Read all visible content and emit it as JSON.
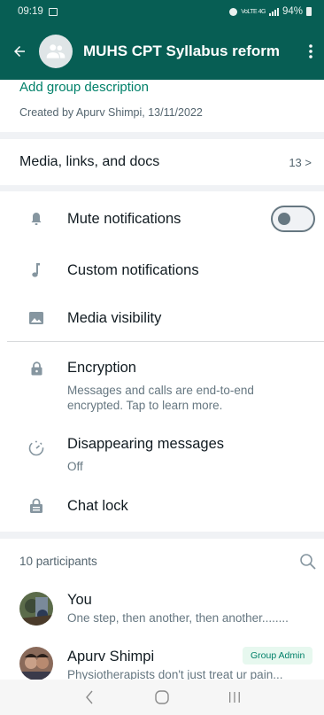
{
  "status_bar": {
    "time": "09:19",
    "network": "VoLTE 4G",
    "battery": "94%"
  },
  "header": {
    "title": "MUHS CPT Syllabus reform",
    "back_icon": "arrow-left-icon",
    "menu_icon": "more-vert-icon",
    "avatar_icon": "group-icon"
  },
  "group_info": {
    "add_description": "Add group description",
    "created_by": "Created by Apurv Shimpi, 13/11/2022"
  },
  "media": {
    "label": "Media, links, and docs",
    "count": "13 >"
  },
  "settings": {
    "mute": {
      "label": "Mute notifications",
      "icon": "bell-icon",
      "enabled": false
    },
    "custom": {
      "label": "Custom notifications",
      "icon": "music-note-icon"
    },
    "visibility": {
      "label": "Media visibility",
      "icon": "image-icon"
    }
  },
  "security": {
    "encryption": {
      "label": "Encryption",
      "sub1": "Messages and calls are end-to-end",
      "sub2": "encrypted. Tap to learn more.",
      "icon": "lock-icon"
    },
    "disappearing": {
      "label": "Disappearing messages",
      "sub": "Off",
      "icon": "timer-icon"
    },
    "chat_lock": {
      "label": "Chat lock",
      "icon": "chat-lock-icon"
    }
  },
  "participants": {
    "count_label": "10 participants",
    "search_icon": "search-icon",
    "items": [
      {
        "name": "You",
        "status": "One step, then another, then another........"
      },
      {
        "name": "Apurv Shimpi",
        "status": "Physiotherapists don't just treat ur pain...",
        "badge": "Group Admin"
      }
    ]
  },
  "nav": {
    "back": "nav-back-icon",
    "home": "nav-home-icon",
    "recents": "nav-recents-icon"
  },
  "colors": {
    "header_bg": "#075e54",
    "accent": "#008069",
    "section_gap": "#f0f2f5"
  }
}
